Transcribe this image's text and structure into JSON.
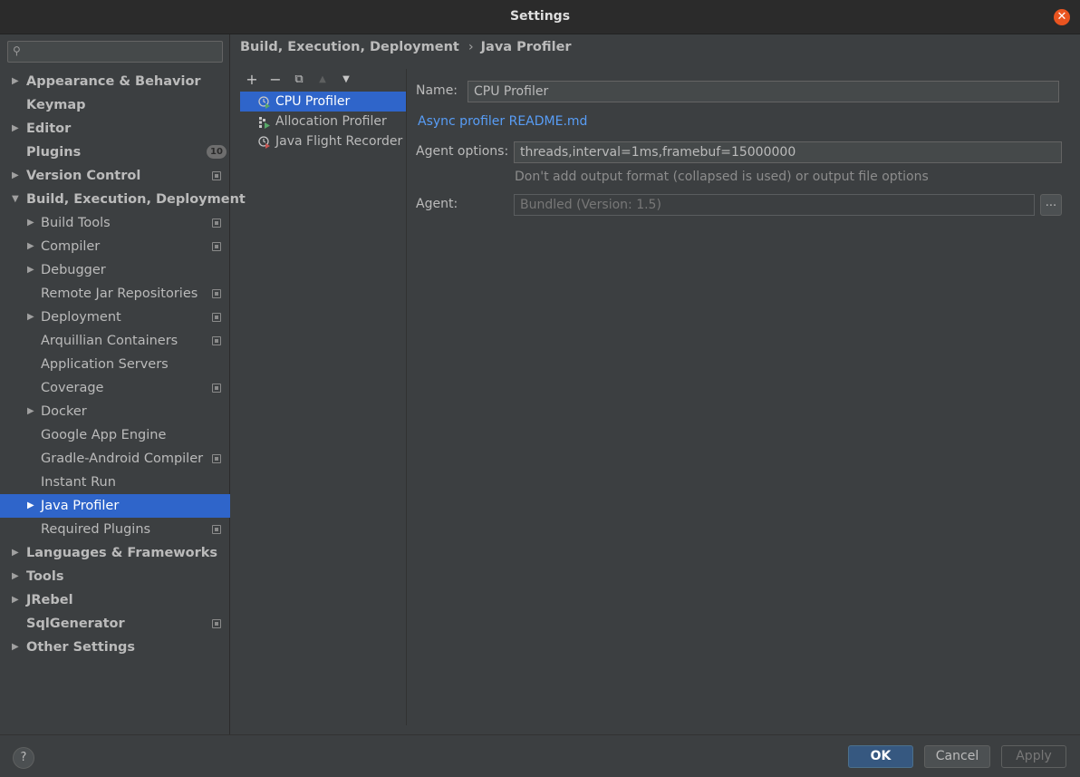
{
  "window": {
    "title": "Settings"
  },
  "sidebar": {
    "search_placeholder": "",
    "items": [
      {
        "label": "Appearance & Behavior",
        "level": 0,
        "bold": true,
        "expandable": true,
        "expanded": false
      },
      {
        "label": "Keymap",
        "level": 0,
        "bold": true,
        "expandable": false
      },
      {
        "label": "Editor",
        "level": 0,
        "bold": true,
        "expandable": true,
        "expanded": false
      },
      {
        "label": "Plugins",
        "level": 0,
        "bold": true,
        "expandable": false,
        "badge": "10"
      },
      {
        "label": "Version Control",
        "level": 0,
        "bold": true,
        "expandable": true,
        "expanded": false,
        "project_icon": true
      },
      {
        "label": "Build, Execution, Deployment",
        "level": 0,
        "bold": true,
        "expandable": true,
        "expanded": true
      },
      {
        "label": "Build Tools",
        "level": 1,
        "expandable": true,
        "expanded": false,
        "project_icon": true
      },
      {
        "label": "Compiler",
        "level": 1,
        "expandable": true,
        "expanded": false,
        "project_icon": true
      },
      {
        "label": "Debugger",
        "level": 1,
        "expandable": true,
        "expanded": false
      },
      {
        "label": "Remote Jar Repositories",
        "level": 1,
        "expandable": false,
        "project_icon": true
      },
      {
        "label": "Deployment",
        "level": 1,
        "expandable": true,
        "expanded": false,
        "project_icon": true
      },
      {
        "label": "Arquillian Containers",
        "level": 1,
        "expandable": false,
        "project_icon": true
      },
      {
        "label": "Application Servers",
        "level": 1,
        "expandable": false
      },
      {
        "label": "Coverage",
        "level": 1,
        "expandable": false,
        "project_icon": true
      },
      {
        "label": "Docker",
        "level": 1,
        "expandable": true,
        "expanded": false
      },
      {
        "label": "Google App Engine",
        "level": 1,
        "expandable": false
      },
      {
        "label": "Gradle-Android Compiler",
        "level": 1,
        "expandable": false,
        "project_icon": true
      },
      {
        "label": "Instant Run",
        "level": 1,
        "expandable": false
      },
      {
        "label": "Java Profiler",
        "level": 1,
        "expandable": true,
        "expanded": false,
        "selected": true
      },
      {
        "label": "Required Plugins",
        "level": 1,
        "expandable": false,
        "project_icon": true
      },
      {
        "label": "Languages & Frameworks",
        "level": 0,
        "bold": true,
        "expandable": true,
        "expanded": false
      },
      {
        "label": "Tools",
        "level": 0,
        "bold": true,
        "expandable": true,
        "expanded": false
      },
      {
        "label": "JRebel",
        "level": 0,
        "bold": true,
        "expandable": true,
        "expanded": false
      },
      {
        "label": "SqlGenerator",
        "level": 0,
        "bold": true,
        "expandable": false,
        "project_icon": true
      },
      {
        "label": "Other Settings",
        "level": 0,
        "bold": true,
        "expandable": true,
        "expanded": false
      }
    ]
  },
  "breadcrumb": {
    "parent": "Build, Execution, Deployment",
    "separator": "›",
    "current": "Java Profiler"
  },
  "toolbar": {
    "add": "+",
    "remove": "−",
    "copy": "⧉",
    "up": "▲",
    "down": "▼"
  },
  "profilers": [
    {
      "label": "CPU Profiler",
      "selected": true,
      "icon": "cpu-profiler-icon"
    },
    {
      "label": "Allocation Profiler",
      "selected": false,
      "icon": "allocation-profiler-icon"
    },
    {
      "label": "Java Flight Recorder",
      "selected": false,
      "icon": "flight-recorder-icon"
    }
  ],
  "form": {
    "name_label": "Name:",
    "name_value": "CPU Profiler",
    "readme_link": "Async profiler README.md",
    "agent_options_label": "Agent options:",
    "agent_options_value": "threads,interval=1ms,framebuf=15000000",
    "agent_options_hint": "Don't add output format (collapsed is used) or output file options",
    "agent_label": "Agent:",
    "agent_value": "Bundled (Version: 1.5)",
    "browse_label": "..."
  },
  "buttons": {
    "help": "?",
    "ok": "OK",
    "cancel": "Cancel",
    "apply": "Apply"
  },
  "colors": {
    "selection": "#2f65ca",
    "link": "#589df6",
    "close": "#e95420"
  }
}
